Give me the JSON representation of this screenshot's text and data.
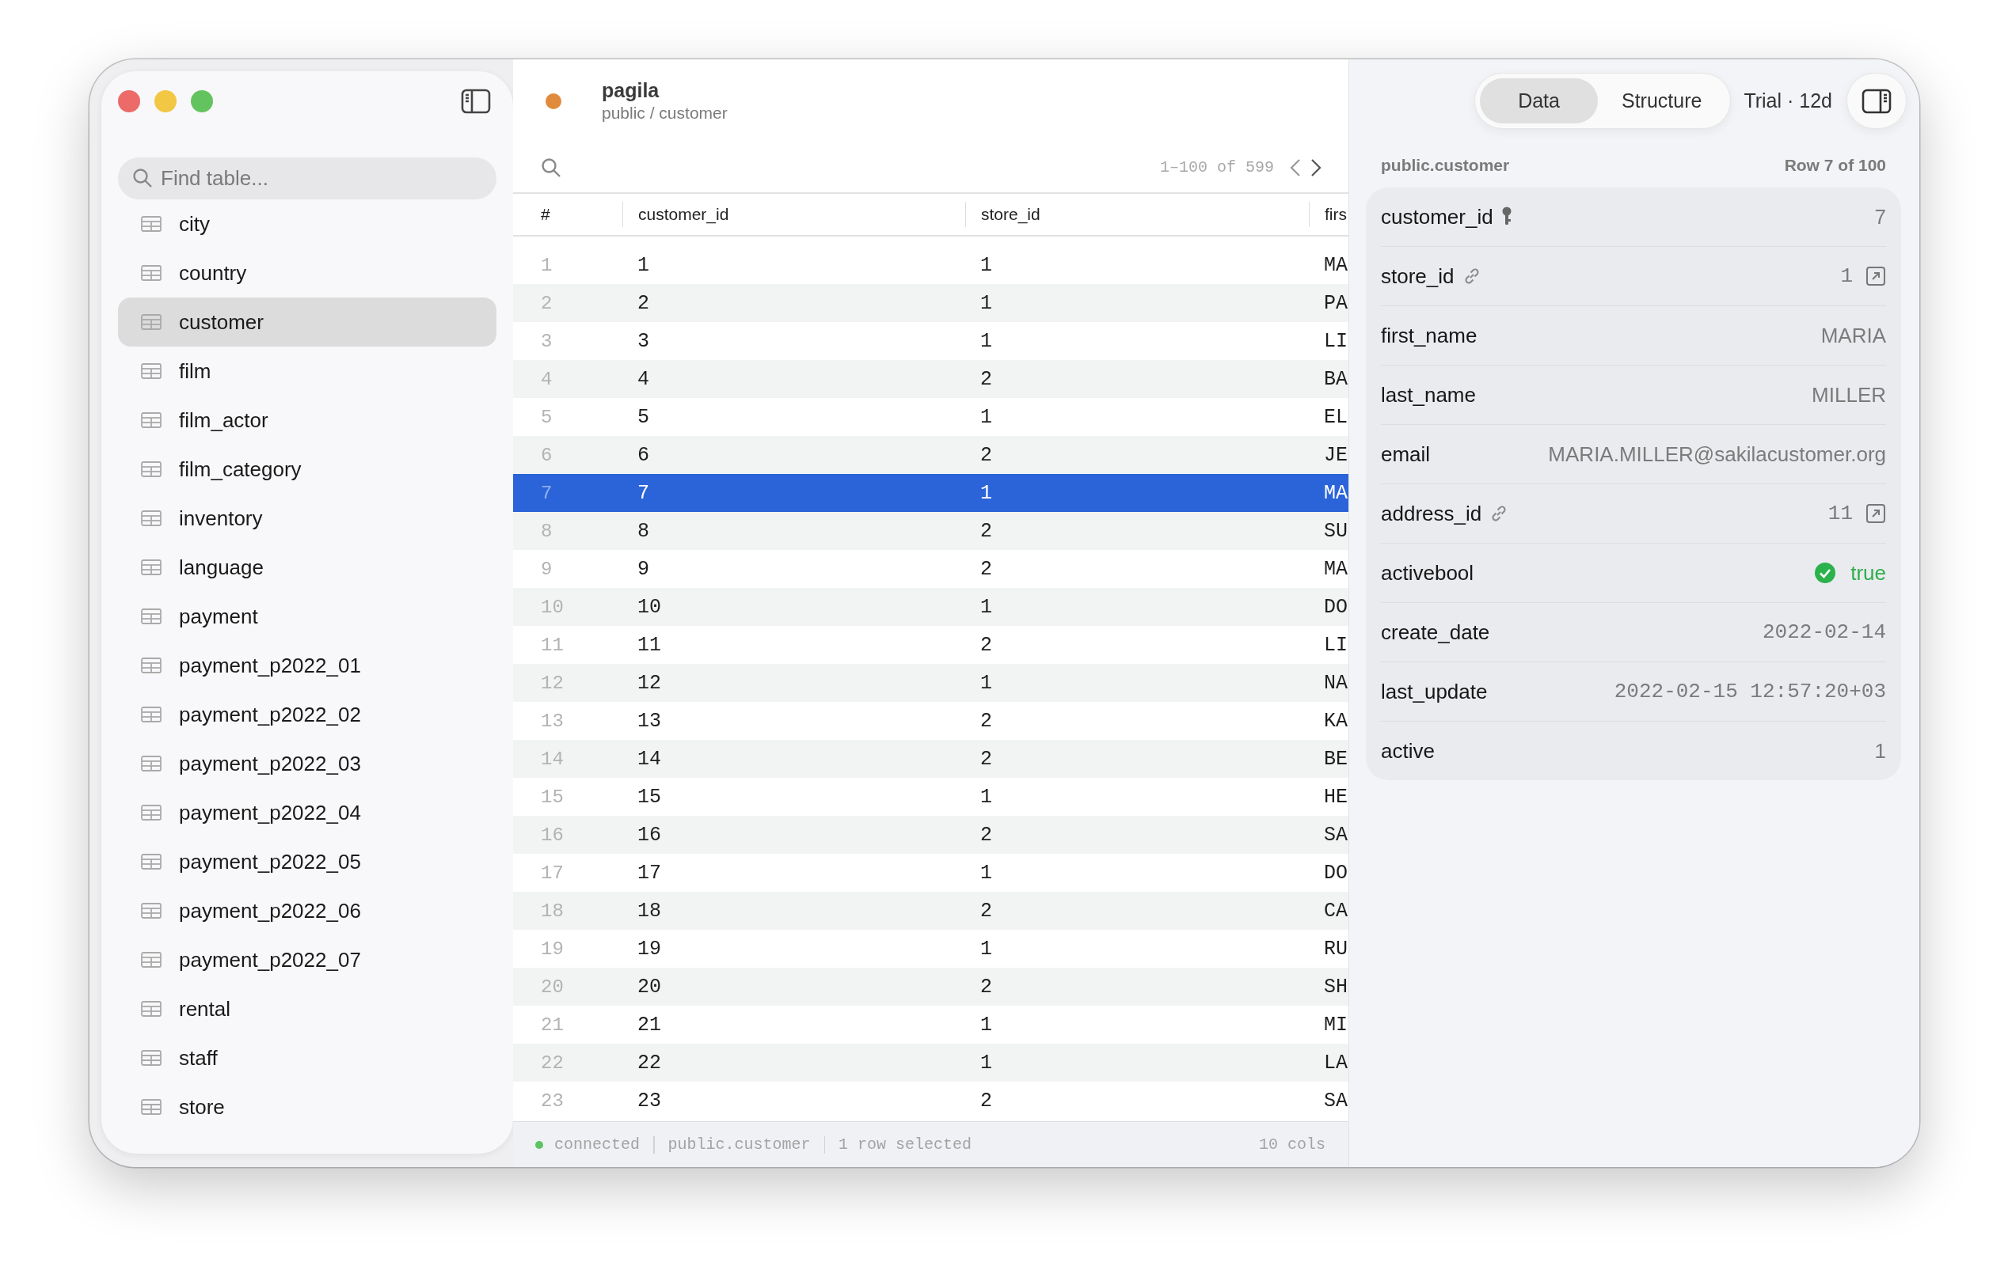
{
  "sidebar": {
    "search": {
      "placeholder": "Find table..."
    },
    "items": [
      {
        "label": "city",
        "selected": false
      },
      {
        "label": "country",
        "selected": false
      },
      {
        "label": "customer",
        "selected": true
      },
      {
        "label": "film",
        "selected": false
      },
      {
        "label": "film_actor",
        "selected": false
      },
      {
        "label": "film_category",
        "selected": false
      },
      {
        "label": "inventory",
        "selected": false
      },
      {
        "label": "language",
        "selected": false
      },
      {
        "label": "payment",
        "selected": false
      },
      {
        "label": "payment_p2022_01",
        "selected": false
      },
      {
        "label": "payment_p2022_02",
        "selected": false
      },
      {
        "label": "payment_p2022_03",
        "selected": false
      },
      {
        "label": "payment_p2022_04",
        "selected": false
      },
      {
        "label": "payment_p2022_05",
        "selected": false
      },
      {
        "label": "payment_p2022_06",
        "selected": false
      },
      {
        "label": "payment_p2022_07",
        "selected": false
      },
      {
        "label": "rental",
        "selected": false
      },
      {
        "label": "staff",
        "selected": false
      },
      {
        "label": "store",
        "selected": false
      }
    ]
  },
  "header": {
    "database": "pagila",
    "path": "public / customer"
  },
  "table": {
    "pagination": "1–100 of 599",
    "columns": [
      "#",
      "customer_id",
      "store_id",
      "firs"
    ],
    "rows": [
      {
        "cells": [
          "1",
          "1",
          "1",
          "MA"
        ],
        "selected": false
      },
      {
        "cells": [
          "2",
          "2",
          "1",
          "PA"
        ],
        "selected": false
      },
      {
        "cells": [
          "3",
          "3",
          "1",
          "LI"
        ],
        "selected": false
      },
      {
        "cells": [
          "4",
          "4",
          "2",
          "BA"
        ],
        "selected": false
      },
      {
        "cells": [
          "5",
          "5",
          "1",
          "EL"
        ],
        "selected": false
      },
      {
        "cells": [
          "6",
          "6",
          "2",
          "JE"
        ],
        "selected": false
      },
      {
        "cells": [
          "7",
          "7",
          "1",
          "MA"
        ],
        "selected": true
      },
      {
        "cells": [
          "8",
          "8",
          "2",
          "SU"
        ],
        "selected": false
      },
      {
        "cells": [
          "9",
          "9",
          "2",
          "MA"
        ],
        "selected": false
      },
      {
        "cells": [
          "10",
          "10",
          "1",
          "DO"
        ],
        "selected": false
      },
      {
        "cells": [
          "11",
          "11",
          "2",
          "LI"
        ],
        "selected": false
      },
      {
        "cells": [
          "12",
          "12",
          "1",
          "NA"
        ],
        "selected": false
      },
      {
        "cells": [
          "13",
          "13",
          "2",
          "KA"
        ],
        "selected": false
      },
      {
        "cells": [
          "14",
          "14",
          "2",
          "BE"
        ],
        "selected": false
      },
      {
        "cells": [
          "15",
          "15",
          "1",
          "HE"
        ],
        "selected": false
      },
      {
        "cells": [
          "16",
          "16",
          "2",
          "SA"
        ],
        "selected": false
      },
      {
        "cells": [
          "17",
          "17",
          "1",
          "DO"
        ],
        "selected": false
      },
      {
        "cells": [
          "18",
          "18",
          "2",
          "CA"
        ],
        "selected": false
      },
      {
        "cells": [
          "19",
          "19",
          "1",
          "RU"
        ],
        "selected": false
      },
      {
        "cells": [
          "20",
          "20",
          "2",
          "SH"
        ],
        "selected": false
      },
      {
        "cells": [
          "21",
          "21",
          "1",
          "MI"
        ],
        "selected": false
      },
      {
        "cells": [
          "22",
          "22",
          "1",
          "LA"
        ],
        "selected": false
      },
      {
        "cells": [
          "23",
          "23",
          "2",
          "SA"
        ],
        "selected": false
      }
    ]
  },
  "status_bar": {
    "items": [
      "connected",
      "public.customer",
      "1 row selected"
    ],
    "columns": "10 cols"
  },
  "detail": {
    "tabs": [
      {
        "label": "Data",
        "selected": true
      },
      {
        "label": "Structure",
        "selected": false
      }
    ],
    "trial": "Trial · 12d",
    "table": "public.customer",
    "position": "Row 7 of 100",
    "fields": [
      {
        "name": "customer_id",
        "value": "7",
        "kind": "key"
      },
      {
        "name": "store_id",
        "value": "1",
        "kind": "foreign"
      },
      {
        "name": "first_name",
        "value": "MARIA",
        "kind": "plain"
      },
      {
        "name": "last_name",
        "value": "MILLER",
        "kind": "plain"
      },
      {
        "name": "email",
        "value": "MARIA.MILLER@sakilacustomer.org",
        "kind": "plain"
      },
      {
        "name": "address_id",
        "value": "11",
        "kind": "foreign"
      },
      {
        "name": "activebool",
        "value": "true",
        "kind": "bool"
      },
      {
        "name": "create_date",
        "value": "2022-02-14",
        "kind": "mono"
      },
      {
        "name": "last_update",
        "value": "2022-02-15 12:57:20+03",
        "kind": "mono"
      },
      {
        "name": "active",
        "value": "1",
        "kind": "plain"
      }
    ]
  }
}
